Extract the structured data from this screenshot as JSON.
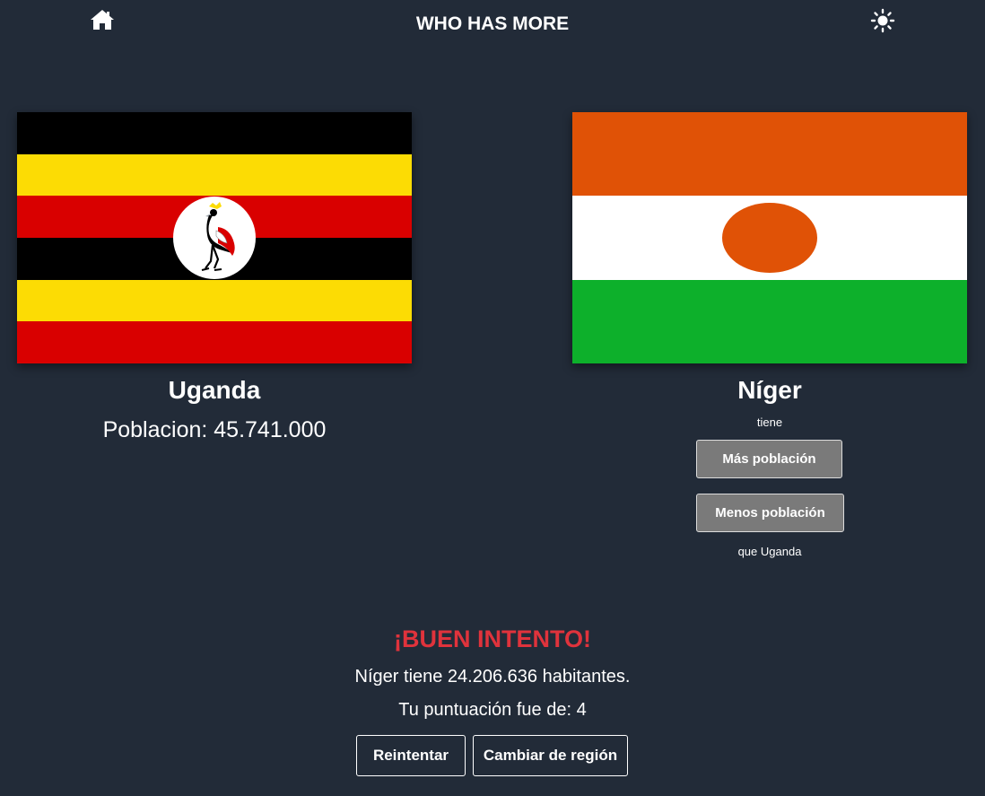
{
  "header": {
    "title": "WHO HAS MORE",
    "home_icon": "home-icon",
    "theme_icon": "sun-icon"
  },
  "left_country": {
    "name": "Uganda",
    "population_text": "Poblacion: 45.741.000",
    "flag": "uganda-flag",
    "flag_colors": [
      "#000000",
      "#fcdc04",
      "#d90000"
    ]
  },
  "right_country": {
    "name": "Níger",
    "flag": "niger-flag",
    "flag_colors": [
      "#e05206",
      "#ffffff",
      "#0db02b"
    ],
    "tiene_label": "tiene",
    "more_button": "Más población",
    "less_button": "Menos población",
    "compare_label": "que Uganda"
  },
  "result": {
    "title": "¡BUEN INTENTO!",
    "detail": "Níger tiene 24.206.636 habitantes.",
    "score_text": "Tu puntuación fue de: 4",
    "retry_button": "Reintentar",
    "change_region_button": "Cambiar de región"
  },
  "colors": {
    "background": "#222b38",
    "button_gray": "#7a7a7a",
    "result_red": "#e0333c"
  }
}
